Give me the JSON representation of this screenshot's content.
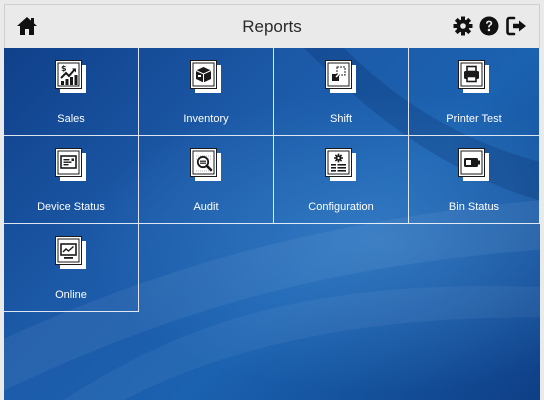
{
  "header": {
    "title": "Reports",
    "icons": [
      "home-icon",
      "settings-icon",
      "help-icon",
      "logout-icon"
    ]
  },
  "tiles": [
    {
      "label": "Sales",
      "icon": "sales-chart-icon"
    },
    {
      "label": "Inventory",
      "icon": "inventory-box-icon"
    },
    {
      "label": "Shift",
      "icon": "shift-transfer-icon"
    },
    {
      "label": "Printer Test",
      "icon": "printer-icon"
    },
    {
      "label": "Device Status",
      "icon": "device-status-icon"
    },
    {
      "label": "Audit",
      "icon": "audit-magnifier-icon"
    },
    {
      "label": "Configuration",
      "icon": "configuration-gear-icon"
    },
    {
      "label": "Bin Status",
      "icon": "bin-battery-icon"
    },
    {
      "label": "Online",
      "icon": "online-monitor-icon"
    }
  ],
  "colors": {
    "header_bg": "#eaeaea",
    "content_blue": "#1b62b0",
    "tile_text": "#ffffff"
  }
}
